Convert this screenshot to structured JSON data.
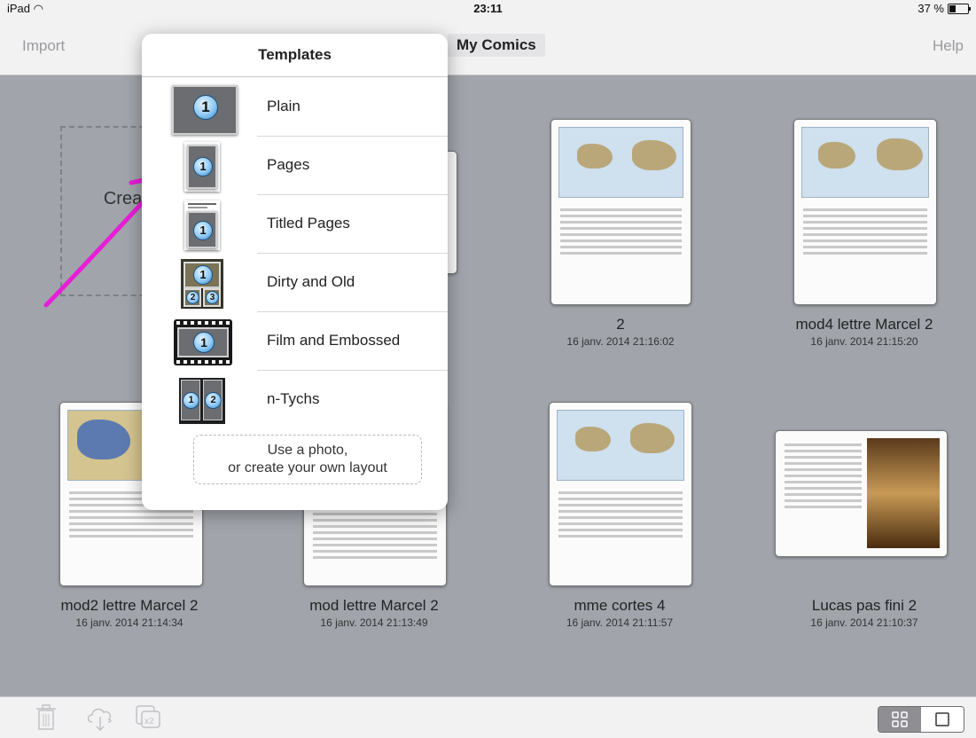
{
  "status_bar": {
    "device": "iPad",
    "time": "23:11",
    "battery": "37 %",
    "battery_level": 0.37
  },
  "nav": {
    "import_label": "Import",
    "title": "My Comics",
    "help_label": "Help"
  },
  "create": {
    "label": "Create new"
  },
  "popover": {
    "title": "Templates",
    "templates": [
      {
        "label": "Plain",
        "icon": "plain-template-icon"
      },
      {
        "label": "Pages",
        "icon": "pages-template-icon"
      },
      {
        "label": "Titled Pages",
        "icon": "titled-pages-template-icon"
      },
      {
        "label": "Dirty and Old",
        "icon": "dirty-old-template-icon"
      },
      {
        "label": "Film and Embossed",
        "icon": "film-embossed-template-icon"
      },
      {
        "label": "n-Tychs",
        "icon": "n-tychs-template-icon"
      }
    ],
    "photo_line1": "Use a photo,",
    "photo_line2": "or create your own layout"
  },
  "comics": [
    {
      "title": "2",
      "date": "16 janv. 2014 21:16:02"
    },
    {
      "title": "mod4 lettre Marcel 2",
      "date": "16 janv. 2014 21:15:20"
    },
    {
      "title": "mod2 lettre Marcel 2",
      "date": "16 janv. 2014 21:14:34"
    },
    {
      "title": "mod lettre Marcel  2",
      "date": "16 janv. 2014 21:13:49"
    },
    {
      "title": "mme cortes 4",
      "date": "16 janv. 2014 21:11:57"
    },
    {
      "title": "Lucas pas fini 2",
      "date": "16 janv. 2014 21:10:37"
    }
  ],
  "toolbar": {
    "icons": [
      "trash-icon",
      "cloud-upload-icon",
      "duplicate-icon"
    ],
    "view_modes": [
      "grid",
      "single"
    ]
  },
  "colors": {
    "annotation": "#e81ed7",
    "background": "#a1a5ab"
  }
}
